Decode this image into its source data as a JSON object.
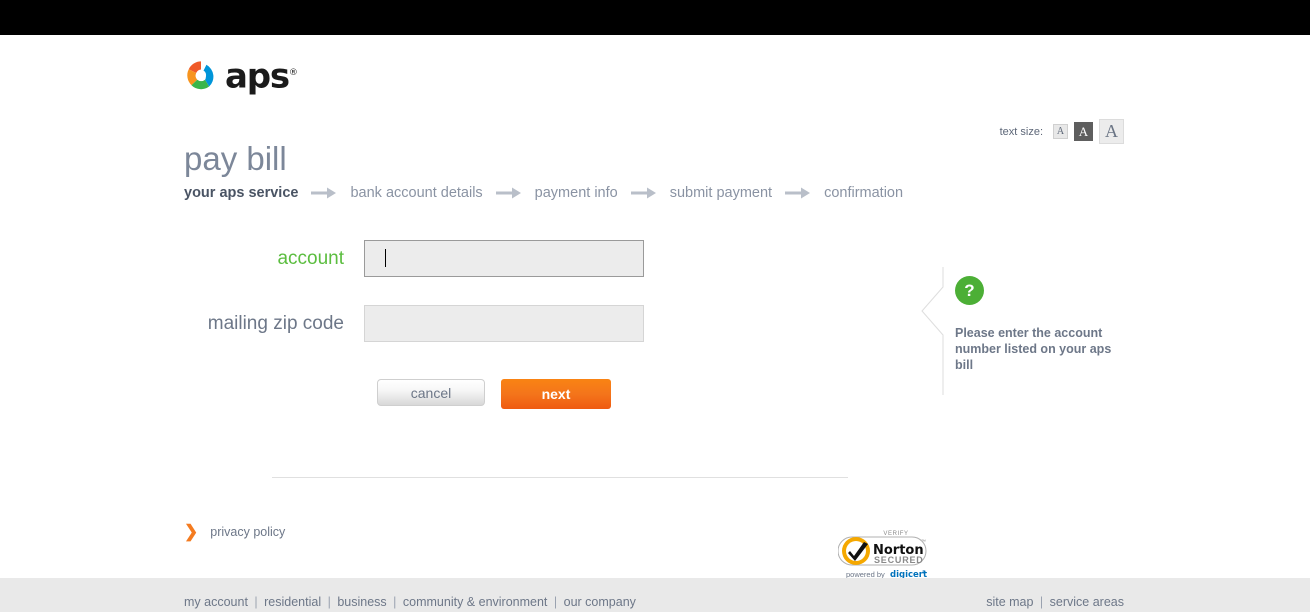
{
  "brand": {
    "logo_text": "aps",
    "logo_registered": "®",
    "logo_icon": "aps-swirl-logo",
    "colors": {
      "orange": "#f05a28",
      "blue": "#0095d9",
      "green": "#4caf36",
      "accent_orange": "#f4751b",
      "title_gray": "#7c8799"
    }
  },
  "header": {
    "page_title": "pay bill"
  },
  "text_size": {
    "label": "text size:",
    "options": [
      {
        "label": "A",
        "size": "small",
        "selected": false
      },
      {
        "label": "A",
        "size": "medium",
        "selected": true
      },
      {
        "label": "A",
        "size": "large",
        "selected": false
      }
    ]
  },
  "steps": [
    {
      "label": "your aps service",
      "active": true
    },
    {
      "label": "bank account details",
      "active": false
    },
    {
      "label": "payment info",
      "active": false
    },
    {
      "label": "submit payment",
      "active": false
    },
    {
      "label": "confirmation",
      "active": false
    }
  ],
  "form": {
    "fields": [
      {
        "label": "account",
        "value": "",
        "placeholder": "",
        "focused": true
      },
      {
        "label": "mailing zip code",
        "value": "",
        "placeholder": "",
        "focused": false
      }
    ],
    "buttons": {
      "cancel": "cancel",
      "next": "next"
    }
  },
  "help": {
    "icon": "question-mark-icon",
    "icon_glyph": "?",
    "text": "Please enter the account number listed on your aps bill"
  },
  "privacy": {
    "icon": "chevron-right-icon",
    "icon_glyph": "❯",
    "label": "privacy policy"
  },
  "norton_badge": {
    "verify": "VERIFY",
    "brand": "Norton",
    "secured": "SECURED",
    "trademark": "™",
    "powered_by": "powered by",
    "provider": "digicert",
    "provider_mark": "®"
  },
  "footer": {
    "left_links": [
      "my account",
      "residential",
      "business",
      "community & environment",
      "our company"
    ],
    "right_links": [
      "site map",
      "service areas"
    ],
    "separator": "|"
  }
}
